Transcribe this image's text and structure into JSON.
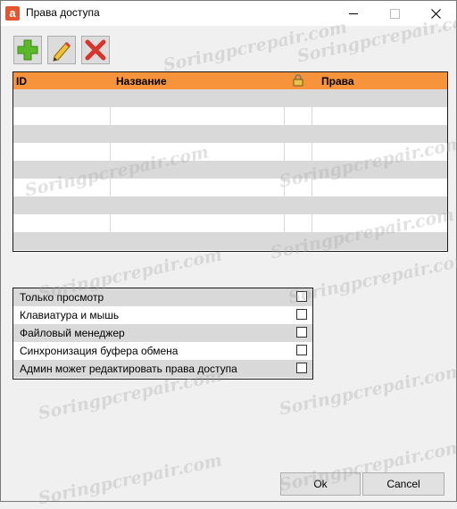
{
  "window": {
    "title": "Права доступа",
    "icon": "anydesk-icon"
  },
  "title_controls": {
    "minimize": "minimize-icon",
    "maximize": "maximize-icon",
    "close": "close-icon"
  },
  "toolbar": {
    "add_icon": "add-icon",
    "edit_icon": "edit-pencil-icon",
    "delete_icon": "delete-icon"
  },
  "grid": {
    "columns": {
      "id": "ID",
      "name": "Название",
      "lock_icon": "lock-icon",
      "rights": "Права"
    },
    "rows": []
  },
  "permissions": [
    {
      "label": "Только просмотр",
      "checked": false
    },
    {
      "label": "Клавиатура и мышь",
      "checked": false
    },
    {
      "label": "Файловый менеджер",
      "checked": false
    },
    {
      "label": "Синхронизация буфера обмена",
      "checked": false
    },
    {
      "label": "Админ может редактировать права доступа",
      "checked": false
    }
  ],
  "buttons": {
    "ok": "Ok",
    "cancel": "Cancel"
  },
  "watermark": "Soringpcrepair.com",
  "colors": {
    "header": "#f7943b",
    "row_alt": "#d9d9d9",
    "add": "#5cb82a",
    "delete": "#d9342b"
  }
}
